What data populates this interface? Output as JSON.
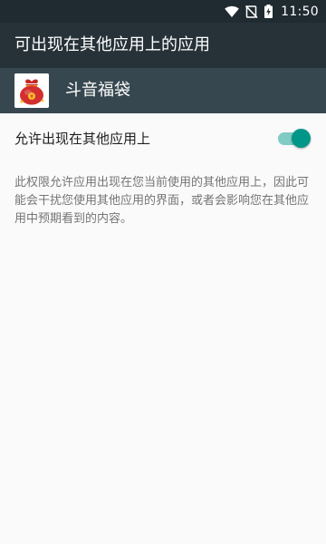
{
  "status_bar": {
    "time": "11:50",
    "icons": [
      "wifi-icon",
      "signal-no-sim-icon",
      "battery-charging-icon"
    ],
    "background": "#1f2b31"
  },
  "toolbar": {
    "title": "可出现在其他应用上的应用",
    "background": "#263238"
  },
  "app_header": {
    "app_name": "斗音福袋",
    "icon": "lucky-bag-icon",
    "background": "#37474f"
  },
  "permission": {
    "label": "允许出现在其他应用上",
    "enabled": true,
    "accent": "#009688",
    "track_color": "#80cbc4"
  },
  "description": "此权限允许应用出现在您当前使用的其他应用上，因此可能会干扰您使用其他应用的界面，或者会影响您在其他应用中预期看到的内容。"
}
